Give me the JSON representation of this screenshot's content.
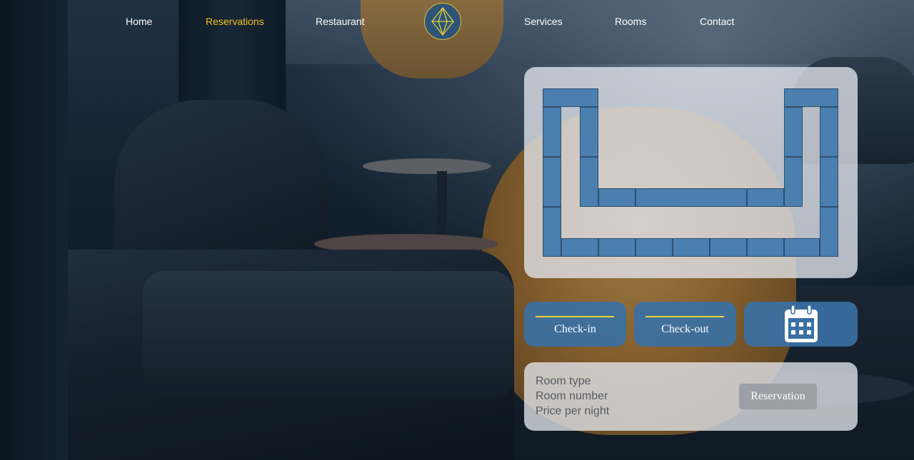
{
  "nav": {
    "home": "Home",
    "reservations": "Reservations",
    "restaurant": "Restaurant",
    "services": "Services",
    "rooms": "Rooms",
    "contact": "Contact",
    "active_color": "#f2c21f"
  },
  "logo": {
    "icon": "diamond-icon"
  },
  "room_map": {
    "room_color": "#4a7fb0",
    "room_count": 29
  },
  "booking": {
    "check_in": "Check-in",
    "check_out": "Check-out",
    "calendar_icon": "calendar-icon"
  },
  "details": {
    "room_type": "Room type",
    "room_number": "Room number",
    "price_per_night": "Price per night",
    "reservation_button": "Reservation"
  }
}
